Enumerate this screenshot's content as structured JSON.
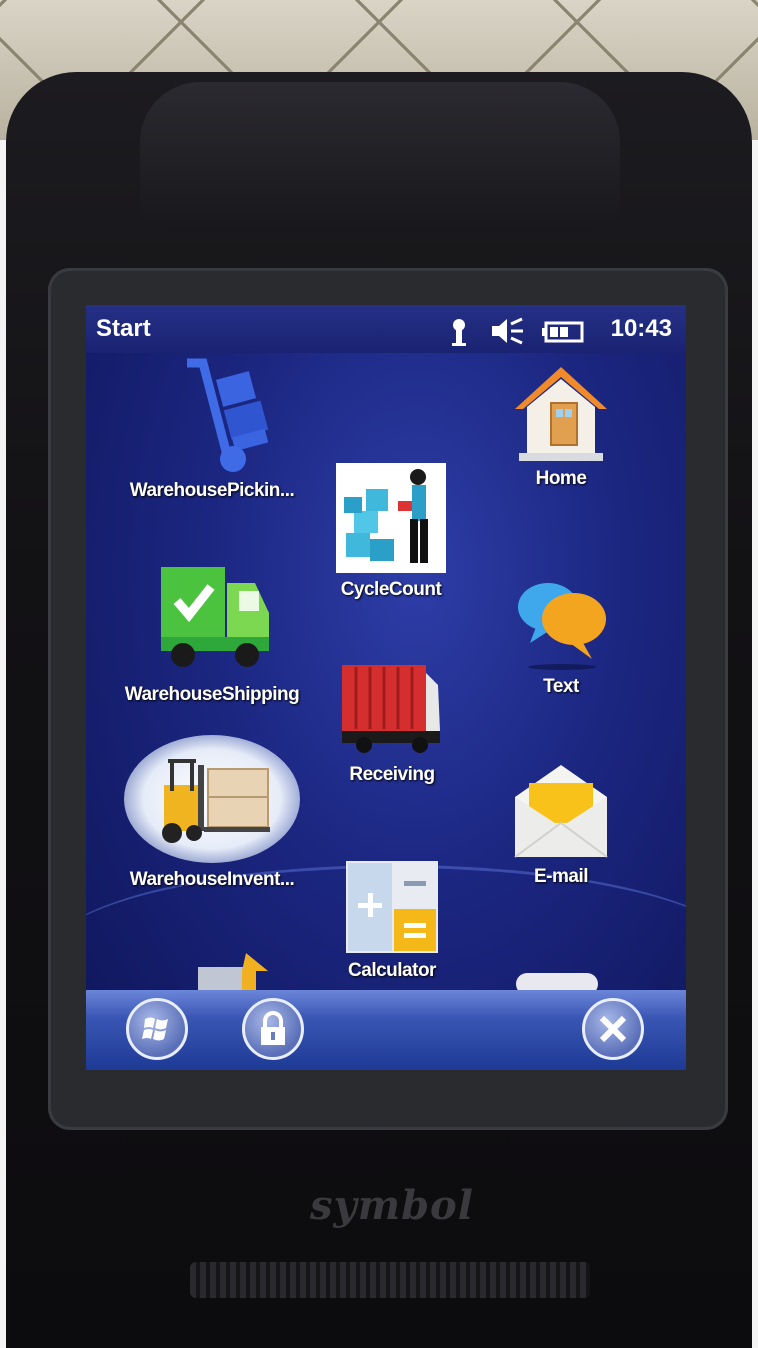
{
  "status_bar": {
    "title": "Start",
    "time": "10:43",
    "icons": [
      "connectivity-icon",
      "speaker-muted-icon",
      "battery-icon"
    ]
  },
  "apps": {
    "warehouse_picking": {
      "label": "WarehousePickin...",
      "icon": "hand-truck-icon"
    },
    "cycle_count": {
      "label": "CycleCount",
      "icon": "worker-boxes-icon"
    },
    "home": {
      "label": "Home",
      "icon": "house-icon"
    },
    "warehouse_shipping": {
      "label": "WarehouseShipping",
      "icon": "delivery-truck-icon"
    },
    "text": {
      "label": "Text",
      "icon": "speech-bubbles-icon"
    },
    "receiving": {
      "label": "Receiving",
      "icon": "cargo-container-icon"
    },
    "warehouse_inventory": {
      "label": "WarehouseInvent...",
      "icon": "forklift-icon"
    },
    "email": {
      "label": "E-mail",
      "icon": "envelope-icon"
    },
    "calculator": {
      "label": "Calculator",
      "icon": "calculator-icon"
    }
  },
  "taskbar": {
    "buttons": [
      "windows-start-icon",
      "lock-icon",
      "close-icon"
    ]
  },
  "device": {
    "brand": "symbol"
  },
  "colors": {
    "screen_bg": "#1b2680",
    "taskbar": "#3a56b4",
    "accent_green": "#4cc33e",
    "accent_orange": "#f0a020"
  }
}
